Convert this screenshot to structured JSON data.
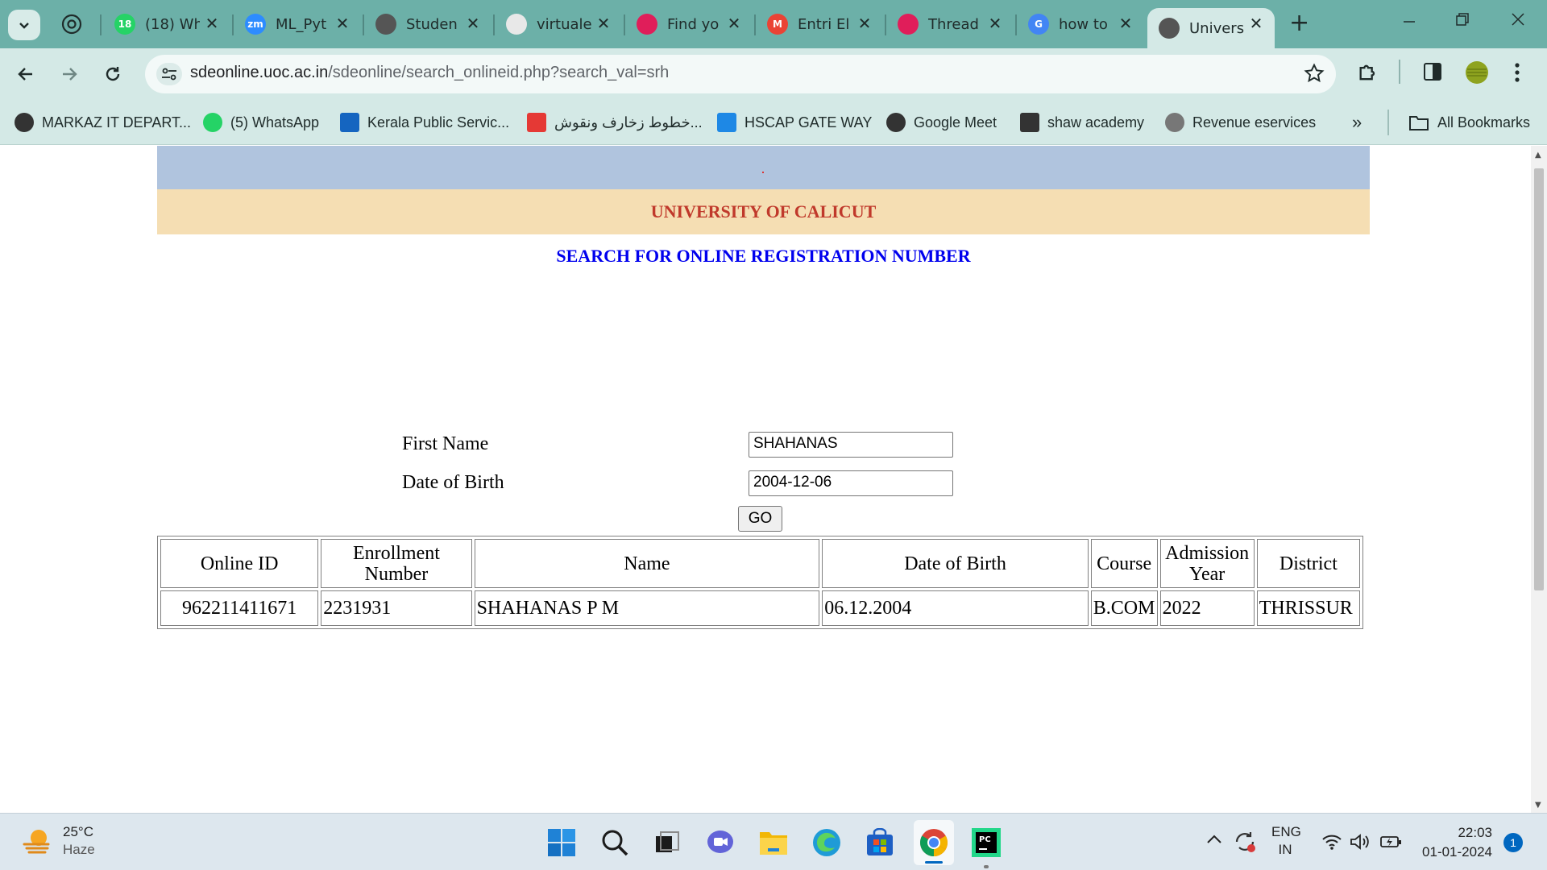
{
  "browser": {
    "tabs": [
      {
        "title": "(18) Wh",
        "icon": "whatsapp-icon",
        "badge": "18",
        "color": "#25d366"
      },
      {
        "title": "ML_Pyt",
        "icon": "zoom-icon",
        "badge": "zm",
        "color": "#2d8cff"
      },
      {
        "title": "Studen",
        "icon": "globe-icon",
        "badge": "",
        "color": "#555555"
      },
      {
        "title": "virtuale",
        "icon": "cube-icon",
        "badge": "",
        "color": "#e8e8e8"
      },
      {
        "title": "Find yo",
        "icon": "slack-icon",
        "badge": "",
        "color": "#e01e5a"
      },
      {
        "title": "Entri El",
        "icon": "gmail-icon",
        "badge": "M",
        "color": "#ea4335"
      },
      {
        "title": "Thread",
        "icon": "slack-icon",
        "badge": "",
        "color": "#e01e5a"
      },
      {
        "title": "how to",
        "icon": "google-icon",
        "badge": "G",
        "color": "#4285f4"
      },
      {
        "title": "Univers",
        "icon": "globe-icon",
        "badge": "",
        "color": "#555555",
        "active": true
      }
    ],
    "new_tab": "+",
    "url_host": "sdeonline.uoc.ac.in",
    "url_path": "/sdeonline/search_onlineid.php?search_val=srh",
    "bookmarks": [
      {
        "label": "MARKAZ IT DEPART...",
        "icon": "globe-icon"
      },
      {
        "label": "(5) WhatsApp",
        "icon": "whatsapp-icon"
      },
      {
        "label": "Kerala Public Servic...",
        "icon": "kpsc-icon"
      },
      {
        "label": "خطوط زخارف ونقوش...",
        "icon": "c-icon"
      },
      {
        "label": "HSCAP GATE WAY",
        "icon": "hs-icon"
      },
      {
        "label": "Google Meet",
        "icon": "globe-icon"
      },
      {
        "label": "shaw academy",
        "icon": "shaw-icon"
      },
      {
        "label": "Revenue eservices",
        "icon": "emblem-icon"
      }
    ],
    "overflow": "»",
    "all_bookmarks": "All Bookmarks"
  },
  "page": {
    "university": "UNIVERSITY OF CALICUT",
    "heading": "SEARCH FOR ONLINE REGISTRATION NUMBER",
    "form": {
      "first_name_label": "First Name",
      "first_name_value": "SHAHANAS",
      "dob_label": "Date of Birth",
      "dob_value": "2004-12-06",
      "go_label": "GO"
    },
    "table": {
      "headers": [
        "Online ID",
        "Enrollment Number",
        "Name",
        "Date of Birth",
        "Course",
        "Admission Year",
        "District"
      ],
      "rows": [
        [
          "962211411671",
          "2231931",
          "SHAHANAS P M",
          "06.12.2004",
          "B.COM",
          "2022",
          "THRISSUR"
        ]
      ]
    }
  },
  "taskbar": {
    "temperature": "25°C",
    "condition": "Haze",
    "lang_top": "ENG",
    "lang_bottom": "IN",
    "time": "22:03",
    "date": "01-01-2024",
    "notification_count": "1"
  }
}
